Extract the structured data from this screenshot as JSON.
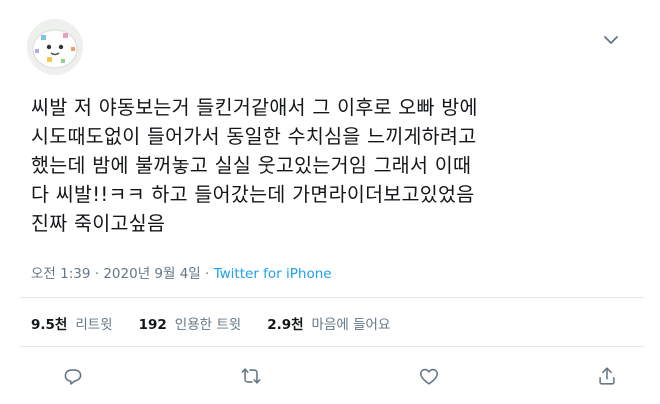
{
  "tweet": {
    "text": "씨발 저 야동보는거 들킨거같애서 그 이후로 오빠 방에\n시도때도없이 들어가서 동일한 수치심을 느끼게하려고\n했는데 밤에 불꺼놓고 실실 웃고있는거임 그래서 이때\n다 씨발!!ㅋㅋ 하고 들어갔는데 가면라이더보고있었음\n진짜 죽이고싶음",
    "time": "오전 1:39",
    "date": "2020년 9월 4일",
    "separator": "·",
    "source": "Twitter for iPhone"
  },
  "stats": {
    "retweets": {
      "count": "9.5천",
      "label": "리트윗"
    },
    "quotes": {
      "count": "192",
      "label": "인용한 트윗"
    },
    "likes": {
      "count": "2.9천",
      "label": "마음에 들어요"
    }
  },
  "icons": {
    "caret": "chevron-down-icon",
    "reply": "reply-icon",
    "retweet": "retweet-icon",
    "like": "heart-icon",
    "share": "share-icon"
  },
  "colors": {
    "text": "#14171a",
    "muted": "#657786",
    "accent": "#1da1f2",
    "divider": "#e3e7ea"
  }
}
